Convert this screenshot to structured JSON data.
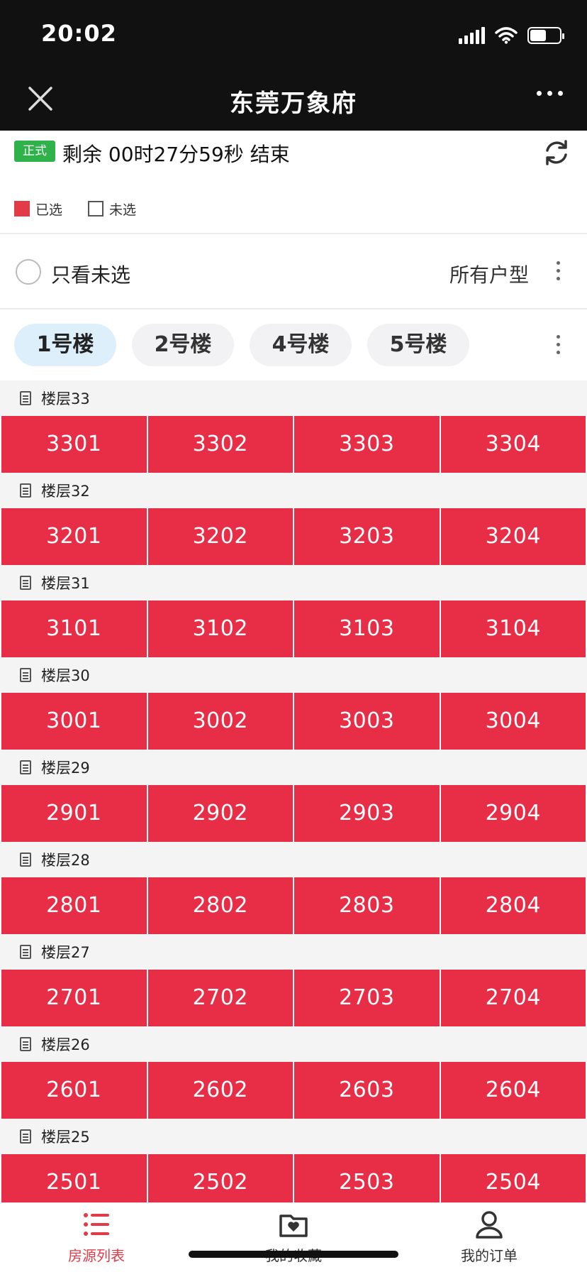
{
  "status": {
    "time": "20:02"
  },
  "nav": {
    "title": "东莞万象府"
  },
  "timer": {
    "badge": "正式",
    "text": "剩余 00时27分59秒 结束"
  },
  "legend": {
    "selected": "已选",
    "unselected": "未选"
  },
  "filter": {
    "only_unselected": "只看未选",
    "type": "所有户型"
  },
  "buildings": [
    {
      "label": "1号楼",
      "active": true
    },
    {
      "label": "2号楼",
      "active": false
    },
    {
      "label": "4号楼",
      "active": false
    },
    {
      "label": "5号楼",
      "active": false
    }
  ],
  "floors": [
    {
      "label": "楼层33",
      "units": [
        "3301",
        "3302",
        "3303",
        "3304"
      ]
    },
    {
      "label": "楼层32",
      "units": [
        "3201",
        "3202",
        "3203",
        "3204"
      ]
    },
    {
      "label": "楼层31",
      "units": [
        "3101",
        "3102",
        "3103",
        "3104"
      ]
    },
    {
      "label": "楼层30",
      "units": [
        "3001",
        "3002",
        "3003",
        "3004"
      ]
    },
    {
      "label": "楼层29",
      "units": [
        "2901",
        "2902",
        "2903",
        "2904"
      ]
    },
    {
      "label": "楼层28",
      "units": [
        "2801",
        "2802",
        "2803",
        "2804"
      ]
    },
    {
      "label": "楼层27",
      "units": [
        "2701",
        "2702",
        "2703",
        "2704"
      ]
    },
    {
      "label": "楼层26",
      "units": [
        "2601",
        "2602",
        "2603",
        "2604"
      ]
    },
    {
      "label": "楼层25",
      "units": [
        "2501",
        "2502",
        "2503",
        "2504"
      ]
    }
  ],
  "bottom_nav": [
    {
      "label": "房源列表",
      "icon": "list-icon",
      "active": true
    },
    {
      "label": "我的收藏",
      "icon": "heart-folder-icon",
      "active": false
    },
    {
      "label": "我的订单",
      "icon": "user-icon",
      "active": false
    }
  ],
  "colors": {
    "unit_selected": "#e72e46",
    "badge": "#2fb24a",
    "active_tab": "#dceffb",
    "accent": "#e23a47"
  }
}
